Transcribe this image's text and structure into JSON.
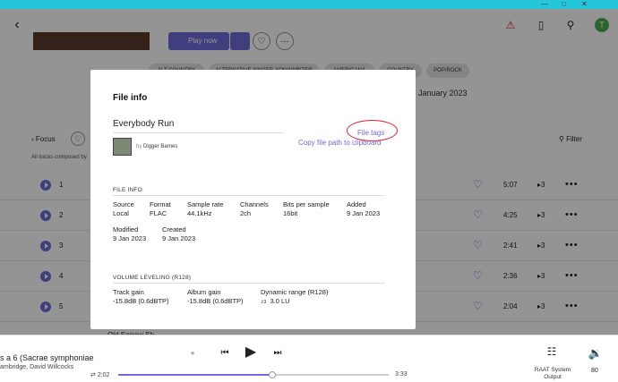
{
  "header": {
    "back_icon": "chevron-left-icon",
    "play_now": "Play now"
  },
  "genres": [
    "ALT-COUNTRY",
    "ALTERNATIVE SINGER-SONGWRITER",
    "AMERICANA",
    "COUNTRY",
    "POP/ROCK"
  ],
  "release_date_partial": "January 2023",
  "toolbar": {
    "focus": "Focus",
    "filter": "Filter",
    "composer_note": "All tracks composed by"
  },
  "tracks": [
    {
      "num": "1",
      "duration": "5:07",
      "count": "3"
    },
    {
      "num": "2",
      "duration": "4:25",
      "count": "3"
    },
    {
      "num": "3",
      "duration": "2:41",
      "count": "3"
    },
    {
      "num": "4",
      "duration": "2:36",
      "count": "3"
    },
    {
      "num": "5",
      "duration": "2:04",
      "count": "3"
    }
  ],
  "modal": {
    "title": "File info",
    "track_title": "Everybody Run",
    "artist_prefix": "by",
    "artist": "Digger Barnes",
    "file_tags_link": "File tags",
    "copy_path_link": "Copy file path to clipboard",
    "file_info": {
      "heading": "FILE INFO",
      "fields": [
        {
          "label": "Source",
          "value": "Local"
        },
        {
          "label": "Format",
          "value": "FLAC"
        },
        {
          "label": "Sample rate",
          "value": "44.1kHz"
        },
        {
          "label": "Channels",
          "value": "2ch"
        },
        {
          "label": "Bits per sample",
          "value": "16bit"
        },
        {
          "label": "Added",
          "value": "9 Jan 2023"
        }
      ],
      "modified_label": "Modified",
      "modified": "9 Jan 2023",
      "created_label": "Created",
      "created": "9 Jan 2023"
    },
    "volume": {
      "heading": "VOLUME LEVELING (R128)",
      "track_gain_label": "Track gain",
      "track_gain": "-15.8dB  (0.6dBTP)",
      "album_gain_label": "Album gain",
      "album_gain": "-15.8dB  (0.6dBTP)",
      "dr_label": "Dynamic range (R128)",
      "dr_sub": "3",
      "dr_value": "3.0 LU"
    }
  },
  "player": {
    "title_partial": "s a 6 (Sacrae symphoniae",
    "artist_partial": "ambridge, David Willcocks",
    "elapsed": "2:02",
    "total": "3:33",
    "progress": 0.57,
    "zone": "RAAT System Output",
    "volume": "80"
  },
  "partial_row_text": "Old Sorrow Sh",
  "avatar_letter": "T",
  "colors": {
    "accent": "#6f6bd8",
    "topbar": "#26c6da",
    "avatar": "#4caf50",
    "highlight": "#e0202a"
  }
}
